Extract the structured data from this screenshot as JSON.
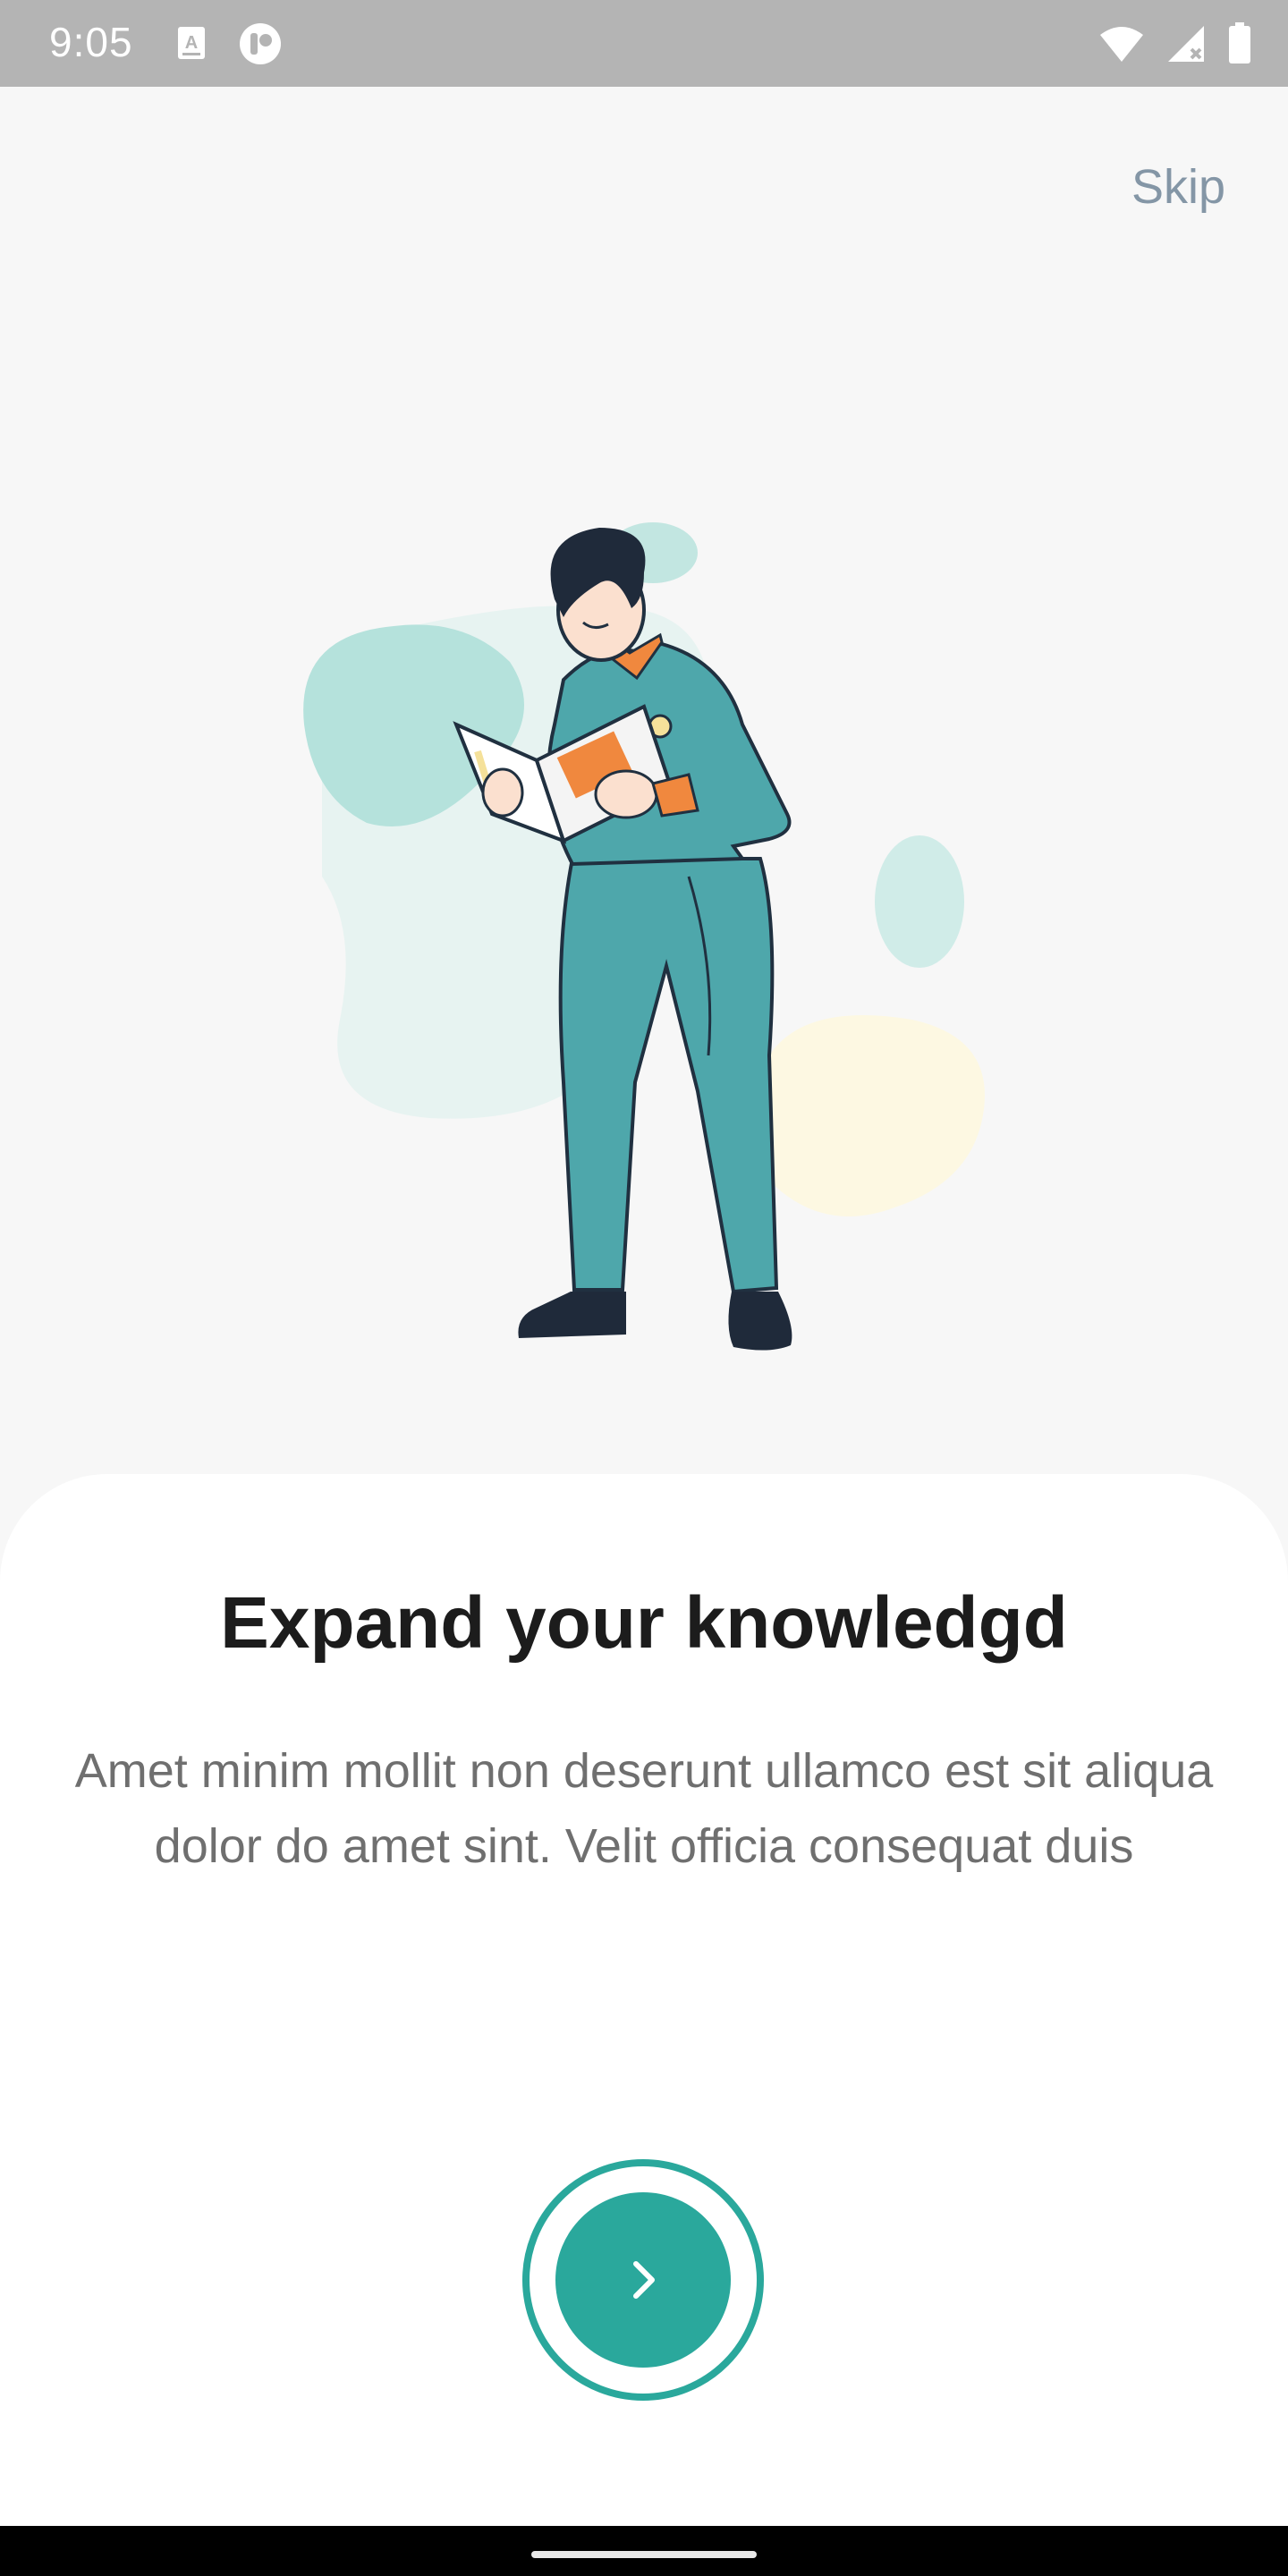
{
  "status_bar": {
    "time": "9:05",
    "icons": [
      "keyboard-a-icon",
      "app-p-icon",
      "wifi-icon",
      "signal-icon",
      "battery-icon"
    ]
  },
  "header": {
    "skip_label": "Skip"
  },
  "onboarding": {
    "title": "Expand your knowledgd",
    "description": "Amet minim mollit non deserunt ullamco est sit aliqua dolor do amet sint. Velit officia consequat duis",
    "next_icon": "chevron-right-icon"
  },
  "colors": {
    "accent": "#2aa89c",
    "background": "#f7f7f7",
    "sheet": "#ffffff",
    "skip_text": "#8496a6"
  }
}
